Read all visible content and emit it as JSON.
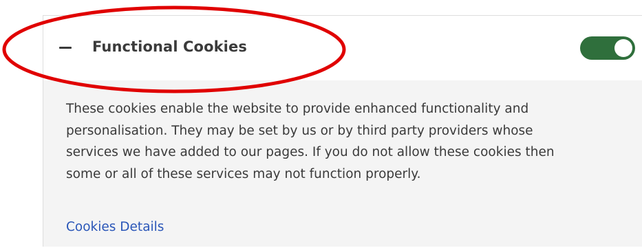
{
  "section": {
    "title": "Functional Cookies",
    "toggle_state": "on",
    "description_lines": [
      "These cookies enable the website to provide enhanced functionality and",
      "personalisation. They may be set by us or by third party providers whose",
      "services we have added to our pages. If you do not allow these cookies then",
      "some or all of these services may not function properly."
    ],
    "details_link": "Cookies Details"
  },
  "colors": {
    "toggle_on": "#2f6f3c",
    "link": "#2a56b8",
    "annotation_ellipse": "#e00000",
    "body_bg": "#f4f4f4"
  },
  "icons": {
    "collapse": "minus-icon"
  }
}
